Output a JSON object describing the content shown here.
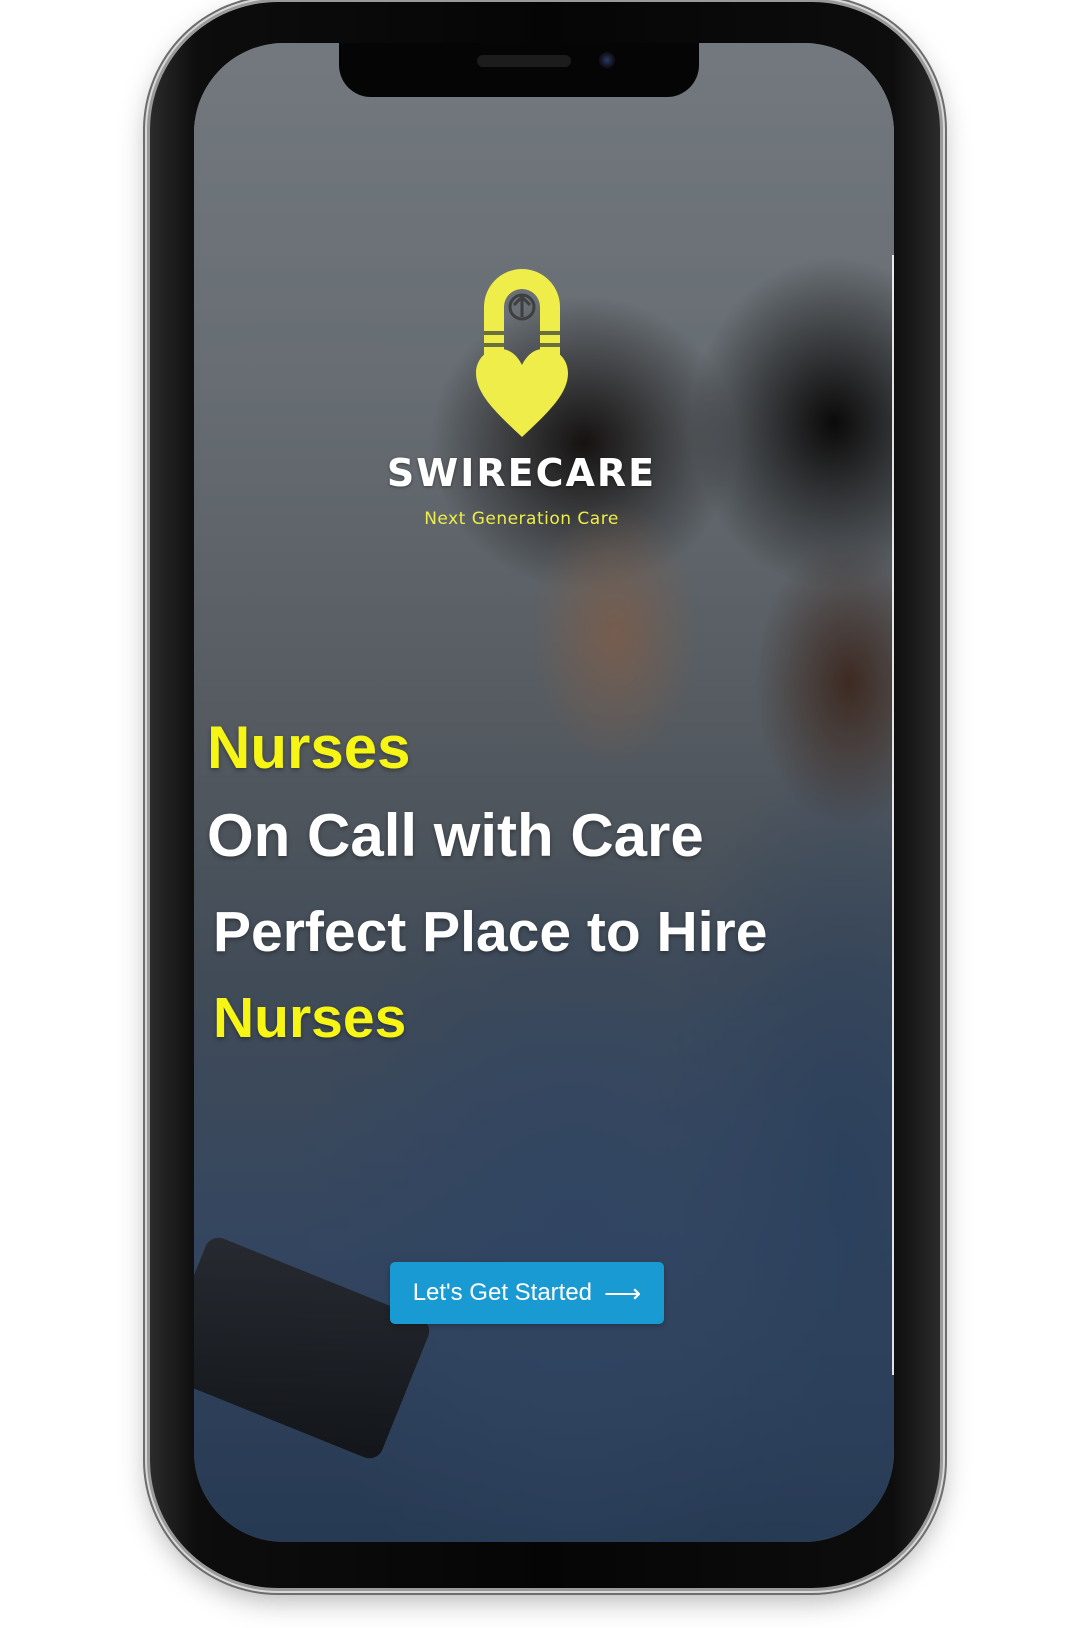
{
  "brand": {
    "name": "SWIRECARE",
    "tagline": "Next Generation Care",
    "accent_color": "#eeed49"
  },
  "hero": {
    "line1": "Nurses",
    "line2": "On Call with Care",
    "line3": "Perfect Place to Hire",
    "line4": "Nurses",
    "highlight_color": "#f6f514",
    "text_color": "#ffffff"
  },
  "cta": {
    "label": "Let's Get Started",
    "icon": "arrow-right-icon",
    "arrow_glyph": "⟶",
    "color": "#1a9ad2"
  },
  "device": {
    "type": "smartphone-mockup"
  }
}
